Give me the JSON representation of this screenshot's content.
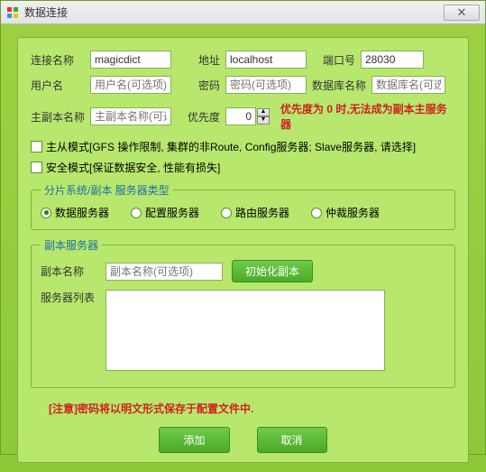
{
  "window": {
    "title": "数据连接"
  },
  "form": {
    "connection_name_label": "连接名称",
    "connection_name_value": "magicdict",
    "address_label": "地址",
    "address_value": "localhost",
    "port_label": "端口号",
    "port_value": "28030",
    "username_label": "用户名",
    "username_placeholder": "用户名(可选项)",
    "password_label": "密码",
    "password_placeholder": "密码(可选项)",
    "dbname_label": "数据库名称",
    "dbname_placeholder": "数据库名(可选)",
    "replica_label": "主副本名称",
    "replica_placeholder": "主副本名称(可选)",
    "priority_label": "优先度",
    "priority_value": "0",
    "priority_note": "优先度为 0 时,无法成为副本主服务器",
    "master_slave_label": "主从模式[GFS 操作限制, 集群的非Route, Config服务器; Slave服务器, 请选择]",
    "safe_mode_label": "安全模式[保证数据安全, 性能有损失]"
  },
  "shard": {
    "legend": "分片系统/副本 服务器类型",
    "options": [
      "数据服务器",
      "配置服务器",
      "路由服务器",
      "仲裁服务器"
    ],
    "selected": 0
  },
  "replica_group": {
    "legend": "副本服务器",
    "name_label": "副本名称",
    "name_placeholder": "副本名称(可选项)",
    "init_button": "初始化副本",
    "server_list_label": "服务器列表"
  },
  "note": "[注意]密码将以明文形式保存于配置文件中.",
  "buttons": {
    "add": "添加",
    "cancel": "取消"
  }
}
